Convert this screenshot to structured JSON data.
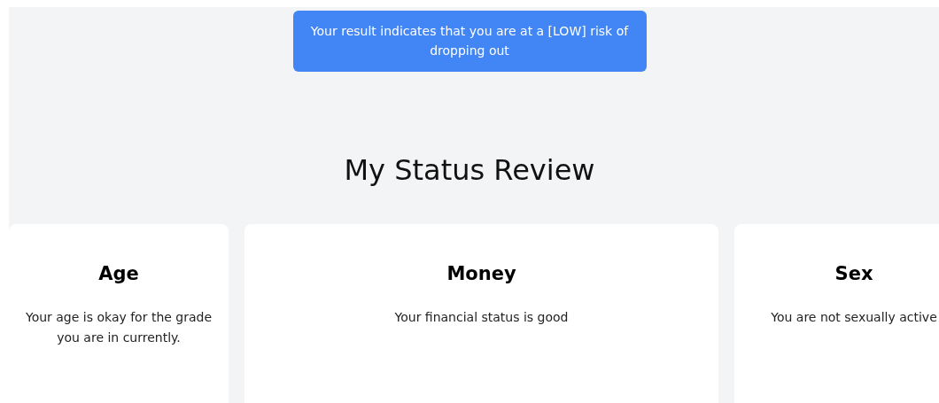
{
  "alert": {
    "text": "Your result indicates that you are at a [LOW] risk of dropping out"
  },
  "heading": "My Status Review",
  "cards": [
    {
      "title": "Age",
      "text": "Your age is okay for the grade you are in currently."
    },
    {
      "title": "Money",
      "text": "Your financial status is good"
    },
    {
      "title": "Sex",
      "text": "You are not sexually active"
    }
  ]
}
